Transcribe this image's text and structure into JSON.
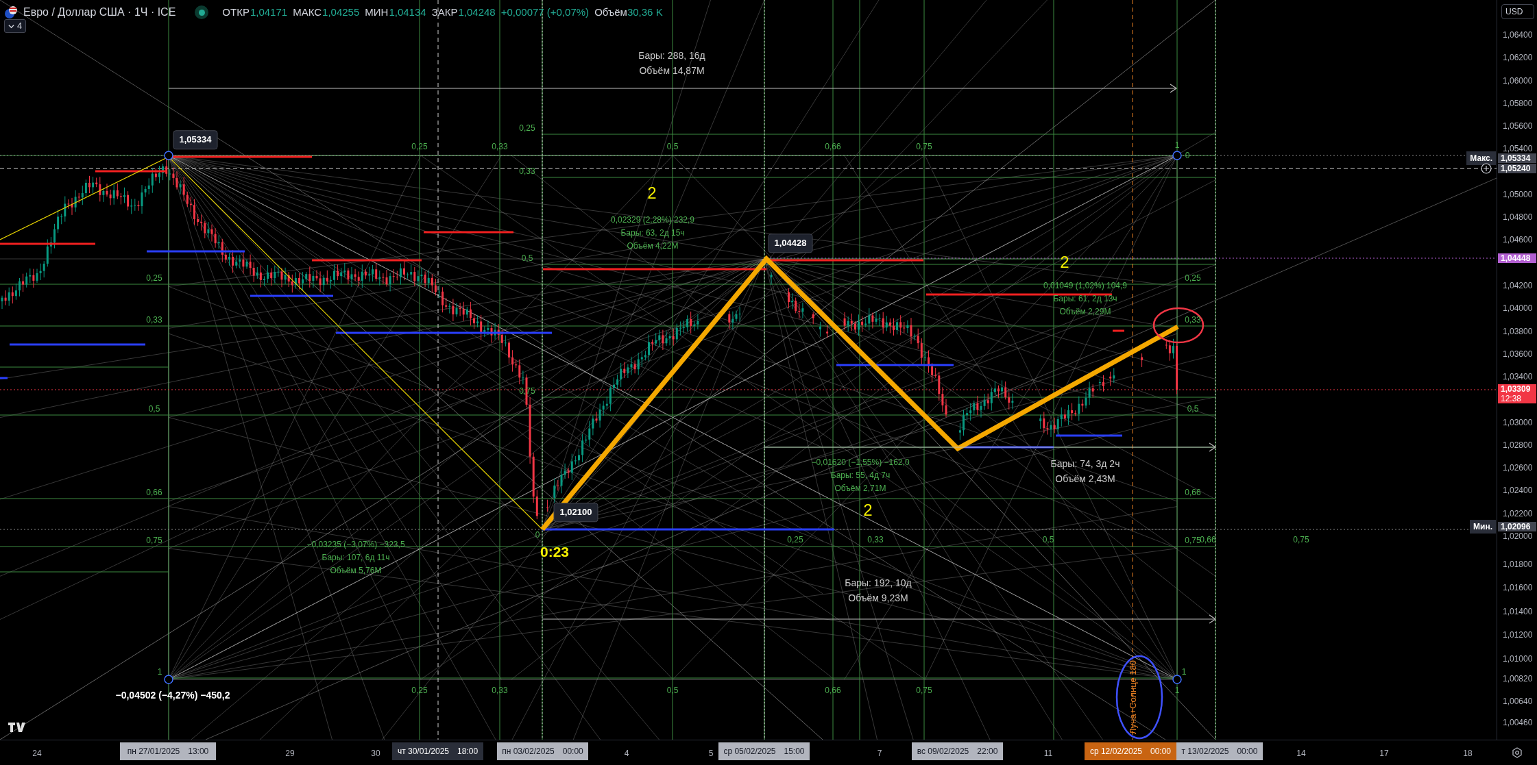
{
  "header": {
    "symbol": "Евро / Доллар США · 1Ч · ICE",
    "ohlc": [
      {
        "label": "ОТКР",
        "value": "1,04171"
      },
      {
        "label": "МАКС",
        "value": "1,04255"
      },
      {
        "label": "МИН",
        "value": "1,04134"
      },
      {
        "label": "ЗАКР",
        "value": "1,04248"
      }
    ],
    "change": "+0,00077 (+0,07%)",
    "volume_label": "Объём",
    "volume": "30,36 K"
  },
  "indicators_toggle": {
    "count": "4",
    "expanded": false
  },
  "chart": {
    "price_labels": [
      "1,05334",
      "1,04428",
      "1,02100"
    ],
    "wave_labels": [
      "2",
      "2",
      "2"
    ],
    "time_mark": "0:23",
    "measurements": [
      {
        "kind": "date_range",
        "lines": [
          "Бары: 288, 16д",
          "Объём 14,87M"
        ]
      },
      {
        "kind": "price_range",
        "lines": [
          "0,02329 (2,28%) 232,9",
          "Бары: 63, 2д 15ч",
          "Объём 4,22M"
        ]
      },
      {
        "kind": "price_range",
        "lines": [
          "0,01049 (1,02%) 104,9",
          "Бары: 61, 2д 13ч",
          "Объём 2,29M"
        ]
      },
      {
        "kind": "price_range",
        "lines": [
          "−0,01620 (−1,55%) −162,0",
          "Бары: 55, 4д 7ч",
          "Объём 2,71M"
        ]
      },
      {
        "kind": "date_range",
        "lines": [
          "Бары: 74, 3д 2ч",
          "Объём 2,43M"
        ]
      },
      {
        "kind": "price_range",
        "lines": [
          "−0,03235 (−3,07%) −323,5",
          "Бары: 107, 6д 11ч",
          "Объём 5,76M"
        ]
      },
      {
        "kind": "date_range",
        "lines": [
          "Бары: 192, 10д",
          "Объём 9,23M"
        ]
      },
      {
        "kind": "total",
        "lines": [
          "−0,04502 (−4,27%) −450,2"
        ]
      }
    ],
    "fib_labels": [
      "0,25",
      "0,33",
      "0,5",
      "0,66",
      "0,75",
      "1",
      "0",
      "0,25",
      "0,33",
      "0,5",
      "0,75",
      "0,25",
      "0,33",
      "0,5",
      "0,66",
      "0,75",
      "1",
      "0,25",
      "0,33",
      "0,5",
      "0,66",
      "0,75",
      "1",
      "0",
      "0,25",
      "0,33",
      "0,5",
      "0,66",
      "0,75",
      "0,25",
      "0,33",
      "0,5",
      "0,66",
      "0,75",
      "1"
    ],
    "vertical_note": "Луна+Солнце 180"
  },
  "price_axis": {
    "currency": "USD",
    "ticks": [
      "1,06400",
      "1,06200",
      "1,06000",
      "1,05800",
      "1,05600",
      "1,05400",
      "1,05000",
      "1,04800",
      "1,04600",
      "1,04200",
      "1,04000",
      "1,03800",
      "1,03600",
      "1,03400",
      "1,03000",
      "1,02800",
      "1,02600",
      "1,02400",
      "1,02200",
      "1,02000",
      "1,01800",
      "1,01600",
      "1,01400",
      "1,01200",
      "1,01000",
      "1,00820",
      "1,00640",
      "1,00460"
    ],
    "badges": [
      {
        "kind": "max",
        "label": "Макс.",
        "value": "1,05334"
      },
      {
        "kind": "plain",
        "value": "1,05240"
      },
      {
        "kind": "alert",
        "value": "1,04448"
      },
      {
        "kind": "last",
        "value": "1,03309",
        "countdown": "12:38"
      },
      {
        "kind": "min",
        "label": "Мин.",
        "value": "1,02096"
      }
    ]
  },
  "time_axis": [
    {
      "kind": "tick",
      "text": "24"
    },
    {
      "kind": "light",
      "date": "пн 27/01/2025",
      "time": "13:00"
    },
    {
      "kind": "tick",
      "text": "29"
    },
    {
      "kind": "tick",
      "text": "30"
    },
    {
      "kind": "dark",
      "date": "чт 30/01/2025",
      "time": "18:00"
    },
    {
      "kind": "light",
      "date": "пн 03/02/2025",
      "time": "00:00"
    },
    {
      "kind": "tick",
      "text": "4"
    },
    {
      "kind": "tick",
      "text": "5"
    },
    {
      "kind": "light",
      "date": "ср 05/02/2025",
      "time": "15:00"
    },
    {
      "kind": "tick",
      "text": "7"
    },
    {
      "kind": "light",
      "date": "вс 09/02/2025",
      "time": "22:00"
    },
    {
      "kind": "tick",
      "text": "11"
    },
    {
      "kind": "orange",
      "date": "ср 12/02/2025",
      "time": "00:00"
    },
    {
      "kind": "light",
      "date": "т 13/02/2025",
      "time": "00:00"
    },
    {
      "kind": "tick",
      "text": "14"
    },
    {
      "kind": "tick",
      "text": "17"
    },
    {
      "kind": "tick",
      "text": "18"
    }
  ]
}
